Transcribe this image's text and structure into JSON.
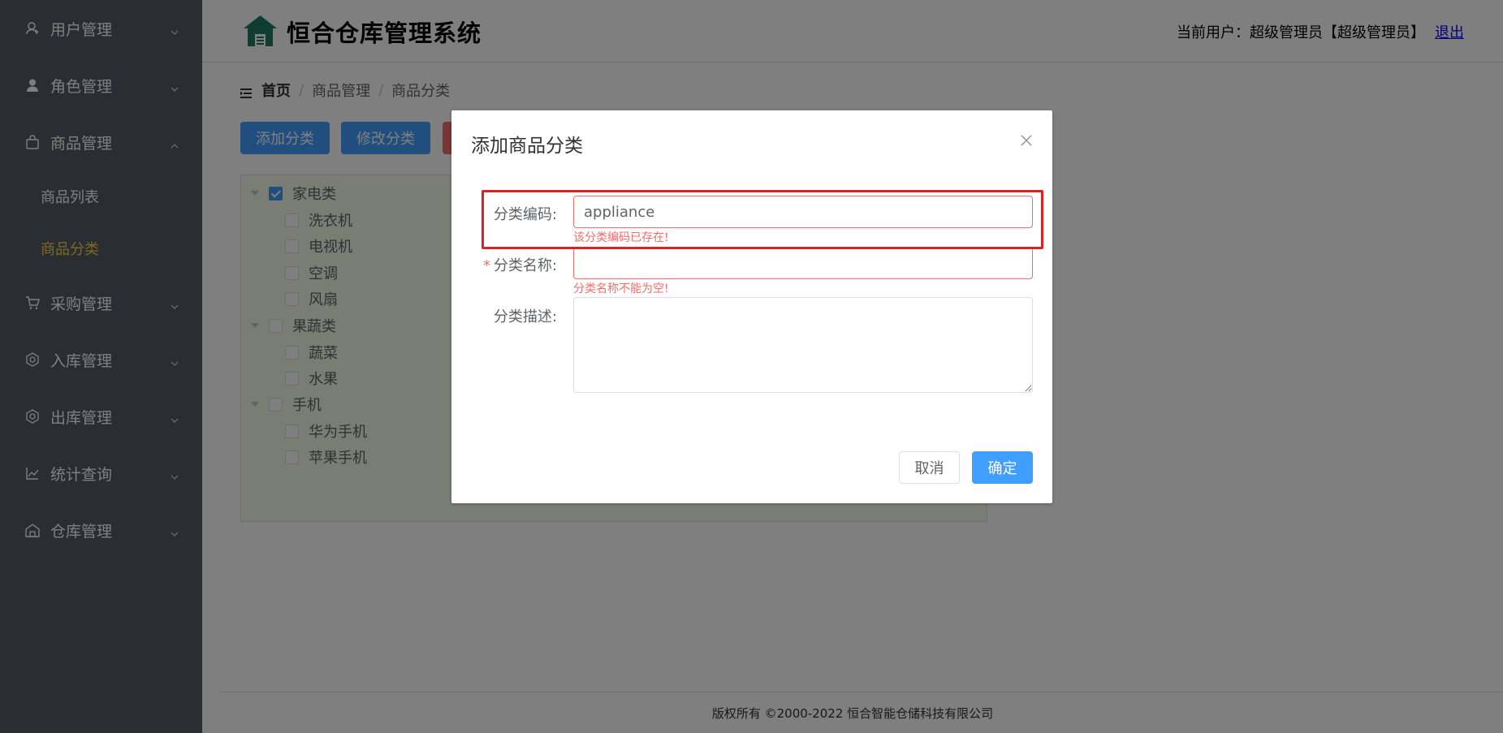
{
  "header": {
    "title": "恒合仓库管理系统",
    "user_info": "当前用户：超级管理员【超级管理员】",
    "logout": "退出",
    "logo_color": "#1a7a60"
  },
  "sidebar": {
    "items": [
      {
        "label": "用户管理",
        "icon": "user-icon"
      },
      {
        "label": "角色管理",
        "icon": "role-icon"
      },
      {
        "label": "商品管理",
        "icon": "bag-icon",
        "expanded": true,
        "children": [
          {
            "label": "商品列表"
          },
          {
            "label": "商品分类",
            "active": true
          }
        ]
      },
      {
        "label": "采购管理",
        "icon": "cart-icon"
      },
      {
        "label": "入库管理",
        "icon": "inbound-icon"
      },
      {
        "label": "出库管理",
        "icon": "outbound-icon"
      },
      {
        "label": "统计查询",
        "icon": "chart-icon"
      },
      {
        "label": "仓库管理",
        "icon": "warehouse-icon"
      }
    ],
    "active_color": "#ffd04b"
  },
  "breadcrumb": {
    "home": "首页",
    "level1": "商品管理",
    "level2": "商品分类"
  },
  "toolbar": {
    "add": "添加分类",
    "edit": "修改分类"
  },
  "tree": {
    "nodes": [
      {
        "label": "家电类",
        "checked": true,
        "children": [
          "洗衣机",
          "电视机",
          "空调",
          "风扇"
        ]
      },
      {
        "label": "果蔬类",
        "checked": false,
        "children": [
          "蔬菜",
          "水果"
        ]
      },
      {
        "label": "手机",
        "checked": false,
        "children": [
          "华为手机",
          "苹果手机"
        ]
      }
    ]
  },
  "footer": {
    "text": "版权所有 ©2000-2022  恒合智能仓储科技有限公司"
  },
  "dialog": {
    "title": "添加商品分类",
    "fields": {
      "code": {
        "label": "分类编码:",
        "value": "appliance",
        "error": "该分类编码已存在!"
      },
      "name": {
        "label": "分类名称:",
        "value": "",
        "error": "分类名称不能为空!",
        "required": true
      },
      "desc": {
        "label": "分类描述:",
        "value": ""
      }
    },
    "cancel": "取消",
    "confirm": "确定"
  },
  "colors": {
    "primary": "#409eff",
    "danger": "#f56c6c",
    "sidebar_bg": "#545c64",
    "highlight": "#e02020"
  }
}
